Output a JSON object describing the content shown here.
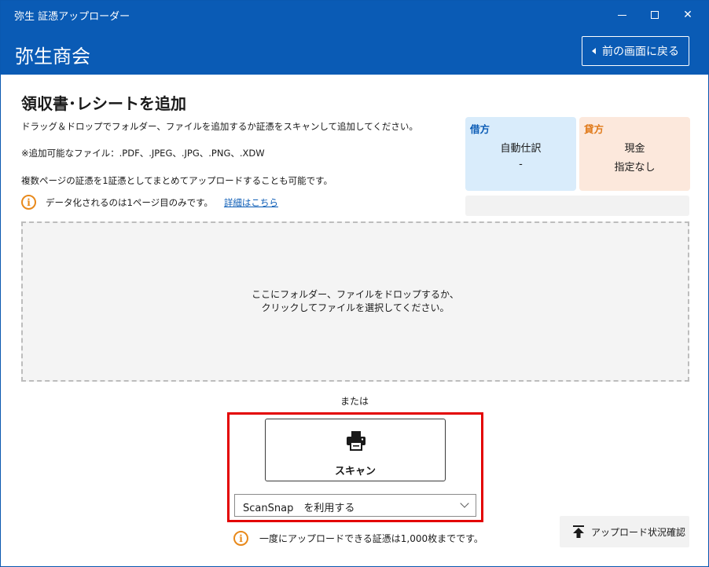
{
  "window": {
    "app_title": "弥生 証憑アップローダー",
    "controls": {
      "minimize": "minimize-icon",
      "maximize": "maximize-icon",
      "close": "✕"
    }
  },
  "header": {
    "company": "弥生商会",
    "back_label": "前の画面に戻る"
  },
  "main": {
    "title": "領収書･レシートを追加",
    "desc_drag": "ドラッグ＆ドロップでフォルダー、ファイルを追加するか証憑をスキャンして追加してください。",
    "desc_types": "※追加可能なファイル：.PDF、.JPEG、.JPG、.PNG、.XDW",
    "desc_multi": "複数ページの証憑を1証憑としてまとめてアップロードすることも可能です。",
    "info_page1": "データ化されるのは1ページ目のみです。",
    "info_link": "詳細はこちら"
  },
  "cards": {
    "debit": {
      "head": "借方",
      "line1": "自動仕訳",
      "line2": "-"
    },
    "credit": {
      "head": "貸方",
      "line1": "現金",
      "line2": "指定なし"
    }
  },
  "dropzone": {
    "line1": "ここにフォルダー、ファイルをドロップするか、",
    "line2": "クリックしてファイルを選択してください。"
  },
  "scan": {
    "or_text": "または",
    "button_label": "スキャン",
    "scanner_selected": "ScanSnap　を利用する"
  },
  "footer": {
    "limit_text": "一度にアップロードできる証憑は1,000枚までです。",
    "status_label": "アップロード状況確認"
  },
  "colors": {
    "header_bg": "#0a5bb5",
    "debit_bg": "#d9ecfb",
    "credit_bg": "#fce8dc",
    "info_orange": "#e8891b",
    "highlight_red": "#e30000",
    "link_blue": "#0a5bb5"
  },
  "icons": {
    "back": "chevron-left-icon",
    "info": "info-icon",
    "scan": "printer-icon",
    "dropdown": "chevron-down-icon",
    "status": "upload-arrow-icon"
  }
}
